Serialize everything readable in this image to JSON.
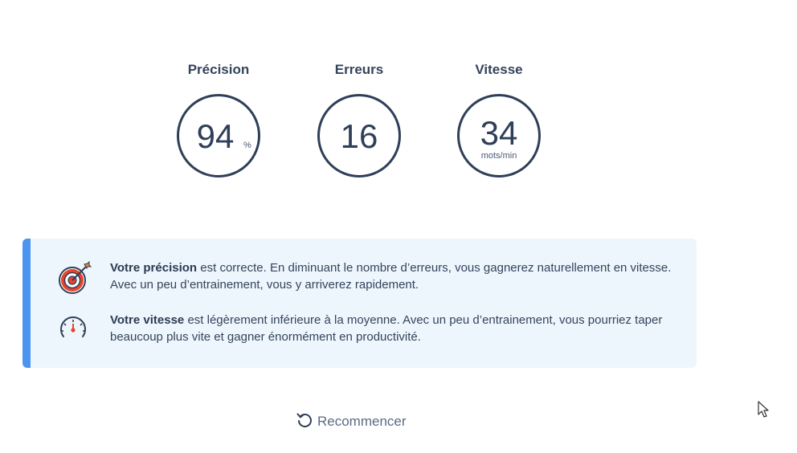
{
  "stats": {
    "precision": {
      "label": "Précision",
      "value": "94",
      "unit": "%"
    },
    "errors": {
      "label": "Erreurs",
      "value": "16"
    },
    "speed": {
      "label": "Vitesse",
      "value": "34",
      "unit": "mots/min"
    }
  },
  "feedback": {
    "precision": {
      "icon": "target-icon",
      "bold": "Votre précision",
      "text": " est correcte. En diminuant le nombre d’erreurs, vous gagnerez naturellement en vitesse. Avec un peu d’entrainement, vous y arriverez rapidement."
    },
    "speed": {
      "icon": "speedometer-icon",
      "bold": "Votre vitesse",
      "text": " est légèrement inférieure à la moyenne. Avec un peu d’entrainement, vous pourriez taper beaucoup plus vite et gagner énormément en productivité."
    }
  },
  "actions": {
    "restart_icon": "restart-icon",
    "restart_label": "Recommencer"
  },
  "colors": {
    "accent": "#4b95f0",
    "panel_bg": "#eef6fd",
    "ring": "#2f3f58",
    "target_red": "#e8442c"
  }
}
